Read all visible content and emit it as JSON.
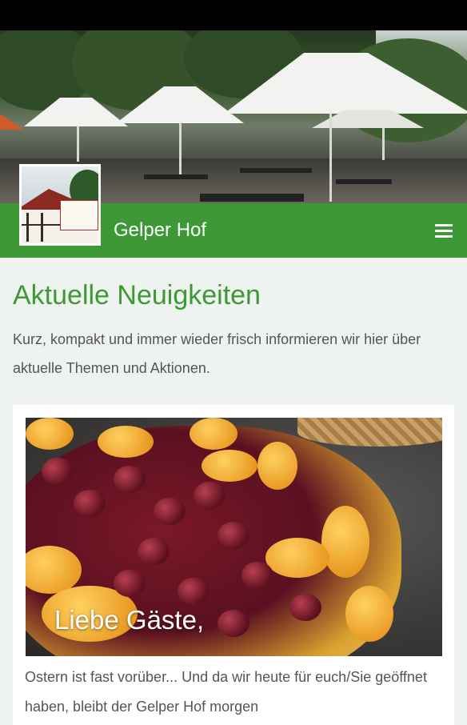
{
  "app": {
    "title": "Gelper Hof",
    "menu_icon": "hamburger-menu-icon"
  },
  "theme": {
    "accent": "#3d9936",
    "background": "#eff3ef"
  },
  "page": {
    "heading": "Aktuelle Neuigkeiten",
    "intro": "Kurz, kompakt und immer wieder frisch informieren wir hier über aktuelle Themen und Aktionen."
  },
  "news": {
    "items": [
      {
        "image_caption": "Liebe Gäste,",
        "text": "Ostern ist fast vorüber... Und da wir heute für euch/Sie geöffnet haben, bleibt der Gelper Hof morgen"
      }
    ]
  }
}
